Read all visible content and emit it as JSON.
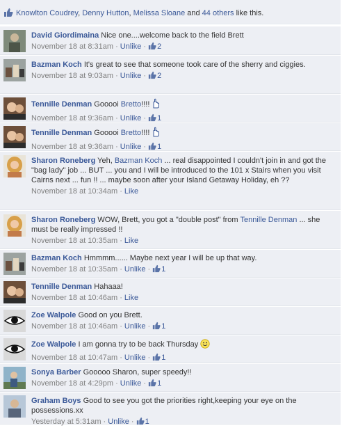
{
  "likes": {
    "people": [
      "Knowlton Coudrey",
      "Denny Hutton",
      "Melissa Sloane"
    ],
    "sep1": ", ",
    "sep2": ", ",
    "and": " and ",
    "others": "44 others",
    "suffix": " like this."
  },
  "comments": [
    {
      "name": "David Giordimaina",
      "text": "Nice one....welcome back to the field Brett",
      "time": "November 18 at 8:31am",
      "unlike": "Unlike",
      "likes": "2"
    },
    {
      "name": "Bazman Koch",
      "text": "It's great to see that someone took care of the sherry and ciggies.",
      "time": "November 18 at 9:03am",
      "unlike": "Unlike",
      "likes": "2"
    },
    {
      "name": "Tennille Denman",
      "text": "Gooooi ",
      "link": "Bretto",
      "text2": "!!!!",
      "time": "November 18 at 9:36am",
      "unlike": "Unlike",
      "likes": "1"
    },
    {
      "name": "Tennille Denman",
      "text": "Gooooi ",
      "link": "Bretto",
      "text2": "!!!!",
      "time": "November 18 at 9:36am",
      "unlike": "Unlike",
      "likes": "1"
    },
    {
      "name": "Sharon Roneberg",
      "text": "Yeh, ",
      "link": "Bazman Koch",
      "text2": " ... real disappointed I couldn't join in and got the \"bag lady\" job ... BUT ... you and I will be introduced to the 101 x Stairs when you visit Cairns next ... fun !! ... maybe soon after your Island Getaway Holiday, eh ??",
      "time": "November 18 at 10:34am",
      "like": "Like"
    },
    {
      "name": "Sharon Roneberg",
      "text": "WOW, Brett, you got a \"double post\" from ",
      "link": "Tennille Denman",
      "text2": " ... she must be really impressed !!",
      "time": "November 18 at 10:35am",
      "like": "Like"
    },
    {
      "name": "Bazman Koch",
      "text": "Hmmmm...... Maybe next year I will be up that way.",
      "time": "November 18 at 10:35am",
      "unlike": "Unlike",
      "likes": "1"
    },
    {
      "name": "Tennille Denman",
      "text": "Hahaaa!",
      "time": "November 18 at 10:46am",
      "like": "Like"
    },
    {
      "name": "Zoe Walpole",
      "text": "Good on you Brett.",
      "time": "November 18 at 10:46am",
      "unlike": "Unlike",
      "likes": "1"
    },
    {
      "name": "Zoe Walpole",
      "text": "I am gonna try to be back Thursday ",
      "time": "November 18 at 10:47am",
      "unlike": "Unlike",
      "likes": "1"
    },
    {
      "name": "Sonya Barber",
      "text": "Gooooo Sharon, super speedy!!",
      "time": "November 18 at 4:29pm",
      "unlike": "Unlike",
      "likes": "1"
    },
    {
      "name": "Graham Boys",
      "text": "Good to see you got the priorities right,keeping your eye on the possessions.xx",
      "time": "Yesterday at 5:31am",
      "unlike": "Unlike",
      "likes": "1"
    }
  ],
  "sep": " · ",
  "colors": {
    "link": "#3b5998",
    "meta": "#808080",
    "bg": "#edeff4"
  }
}
